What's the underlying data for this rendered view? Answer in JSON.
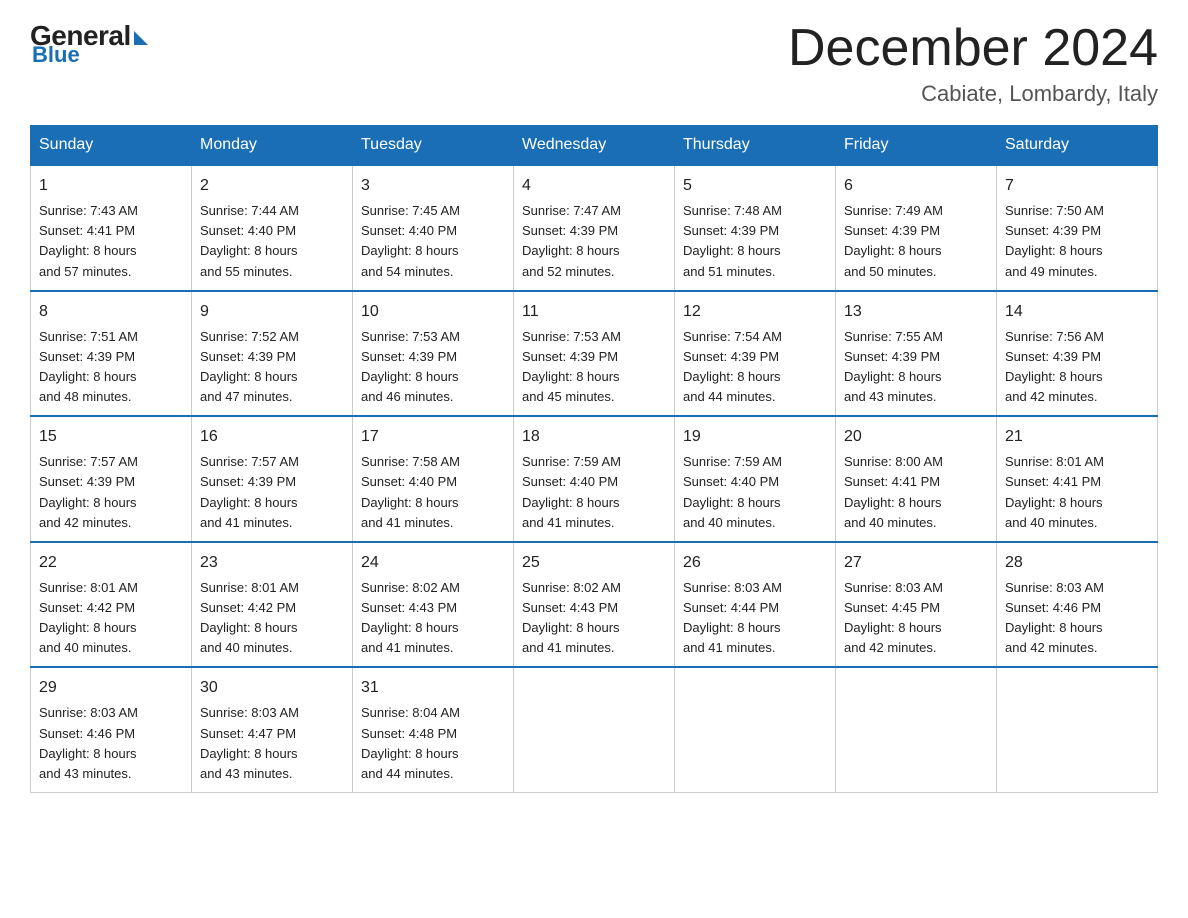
{
  "header": {
    "logo": {
      "general": "General",
      "blue": "Blue"
    },
    "title": "December 2024",
    "location": "Cabiate, Lombardy, Italy"
  },
  "weekdays": [
    "Sunday",
    "Monday",
    "Tuesday",
    "Wednesday",
    "Thursday",
    "Friday",
    "Saturday"
  ],
  "weeks": [
    [
      {
        "day": "1",
        "sunrise": "7:43 AM",
        "sunset": "4:41 PM",
        "daylight": "8 hours and 57 minutes."
      },
      {
        "day": "2",
        "sunrise": "7:44 AM",
        "sunset": "4:40 PM",
        "daylight": "8 hours and 55 minutes."
      },
      {
        "day": "3",
        "sunrise": "7:45 AM",
        "sunset": "4:40 PM",
        "daylight": "8 hours and 54 minutes."
      },
      {
        "day": "4",
        "sunrise": "7:47 AM",
        "sunset": "4:39 PM",
        "daylight": "8 hours and 52 minutes."
      },
      {
        "day": "5",
        "sunrise": "7:48 AM",
        "sunset": "4:39 PM",
        "daylight": "8 hours and 51 minutes."
      },
      {
        "day": "6",
        "sunrise": "7:49 AM",
        "sunset": "4:39 PM",
        "daylight": "8 hours and 50 minutes."
      },
      {
        "day": "7",
        "sunrise": "7:50 AM",
        "sunset": "4:39 PM",
        "daylight": "8 hours and 49 minutes."
      }
    ],
    [
      {
        "day": "8",
        "sunrise": "7:51 AM",
        "sunset": "4:39 PM",
        "daylight": "8 hours and 48 minutes."
      },
      {
        "day": "9",
        "sunrise": "7:52 AM",
        "sunset": "4:39 PM",
        "daylight": "8 hours and 47 minutes."
      },
      {
        "day": "10",
        "sunrise": "7:53 AM",
        "sunset": "4:39 PM",
        "daylight": "8 hours and 46 minutes."
      },
      {
        "day": "11",
        "sunrise": "7:53 AM",
        "sunset": "4:39 PM",
        "daylight": "8 hours and 45 minutes."
      },
      {
        "day": "12",
        "sunrise": "7:54 AM",
        "sunset": "4:39 PM",
        "daylight": "8 hours and 44 minutes."
      },
      {
        "day": "13",
        "sunrise": "7:55 AM",
        "sunset": "4:39 PM",
        "daylight": "8 hours and 43 minutes."
      },
      {
        "day": "14",
        "sunrise": "7:56 AM",
        "sunset": "4:39 PM",
        "daylight": "8 hours and 42 minutes."
      }
    ],
    [
      {
        "day": "15",
        "sunrise": "7:57 AM",
        "sunset": "4:39 PM",
        "daylight": "8 hours and 42 minutes."
      },
      {
        "day": "16",
        "sunrise": "7:57 AM",
        "sunset": "4:39 PM",
        "daylight": "8 hours and 41 minutes."
      },
      {
        "day": "17",
        "sunrise": "7:58 AM",
        "sunset": "4:40 PM",
        "daylight": "8 hours and 41 minutes."
      },
      {
        "day": "18",
        "sunrise": "7:59 AM",
        "sunset": "4:40 PM",
        "daylight": "8 hours and 41 minutes."
      },
      {
        "day": "19",
        "sunrise": "7:59 AM",
        "sunset": "4:40 PM",
        "daylight": "8 hours and 40 minutes."
      },
      {
        "day": "20",
        "sunrise": "8:00 AM",
        "sunset": "4:41 PM",
        "daylight": "8 hours and 40 minutes."
      },
      {
        "day": "21",
        "sunrise": "8:01 AM",
        "sunset": "4:41 PM",
        "daylight": "8 hours and 40 minutes."
      }
    ],
    [
      {
        "day": "22",
        "sunrise": "8:01 AM",
        "sunset": "4:42 PM",
        "daylight": "8 hours and 40 minutes."
      },
      {
        "day": "23",
        "sunrise": "8:01 AM",
        "sunset": "4:42 PM",
        "daylight": "8 hours and 40 minutes."
      },
      {
        "day": "24",
        "sunrise": "8:02 AM",
        "sunset": "4:43 PM",
        "daylight": "8 hours and 41 minutes."
      },
      {
        "day": "25",
        "sunrise": "8:02 AM",
        "sunset": "4:43 PM",
        "daylight": "8 hours and 41 minutes."
      },
      {
        "day": "26",
        "sunrise": "8:03 AM",
        "sunset": "4:44 PM",
        "daylight": "8 hours and 41 minutes."
      },
      {
        "day": "27",
        "sunrise": "8:03 AM",
        "sunset": "4:45 PM",
        "daylight": "8 hours and 42 minutes."
      },
      {
        "day": "28",
        "sunrise": "8:03 AM",
        "sunset": "4:46 PM",
        "daylight": "8 hours and 42 minutes."
      }
    ],
    [
      {
        "day": "29",
        "sunrise": "8:03 AM",
        "sunset": "4:46 PM",
        "daylight": "8 hours and 43 minutes."
      },
      {
        "day": "30",
        "sunrise": "8:03 AM",
        "sunset": "4:47 PM",
        "daylight": "8 hours and 43 minutes."
      },
      {
        "day": "31",
        "sunrise": "8:04 AM",
        "sunset": "4:48 PM",
        "daylight": "8 hours and 44 minutes."
      },
      null,
      null,
      null,
      null
    ]
  ]
}
